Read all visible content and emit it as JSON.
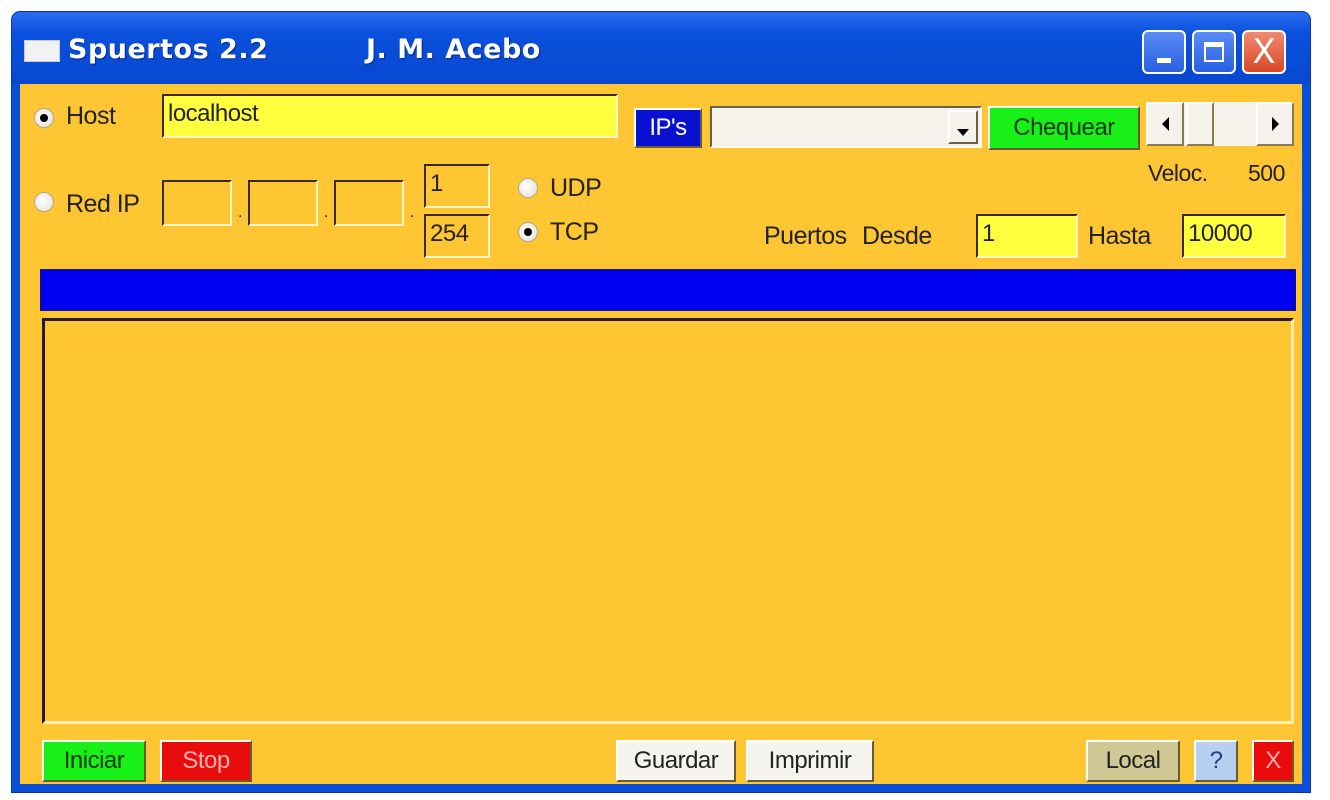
{
  "window": {
    "title": "Spuertos 2.2",
    "author": "J. M. Acebo",
    "controls": {
      "minimize": "minimize",
      "maximize": "maximize",
      "close": "X"
    }
  },
  "target": {
    "host_label": "Host",
    "host_selected": true,
    "host_value": "localhost",
    "ips_button": "IP's",
    "ip_combo_value": "",
    "check_button": "Chequear",
    "red_ip_label": "Red IP",
    "red_ip_selected": false,
    "ip_octets": [
      "",
      "",
      ""
    ],
    "range_from": "1",
    "range_to": "254"
  },
  "protocol": {
    "udp_label": "UDP",
    "udp_selected": false,
    "tcp_label": "TCP",
    "tcp_selected": true
  },
  "speed": {
    "label": "Veloc.",
    "value": "500"
  },
  "ports": {
    "label": "Puertos",
    "from_label": "Desde",
    "from_value": "1",
    "to_label": "Hasta",
    "to_value": "10000"
  },
  "progress": {
    "fraction": 1.0
  },
  "output": {
    "text": ""
  },
  "footer": {
    "start_button": "Iniciar",
    "stop_button": "Stop",
    "save_button": "Guardar",
    "print_button": "Imprimir",
    "local_button": "Local",
    "help_button": "?",
    "exit_button": "X"
  },
  "colors": {
    "client_bg": "#fec632",
    "field_yellow": "#ffff40",
    "progress_blue": "#0000f0",
    "green_button": "#18f018",
    "red_button": "#e80c0c",
    "ips_button_bg": "#0a10d0",
    "local_button_bg": "#cfc895",
    "help_button_bg": "#b8d0f0"
  }
}
